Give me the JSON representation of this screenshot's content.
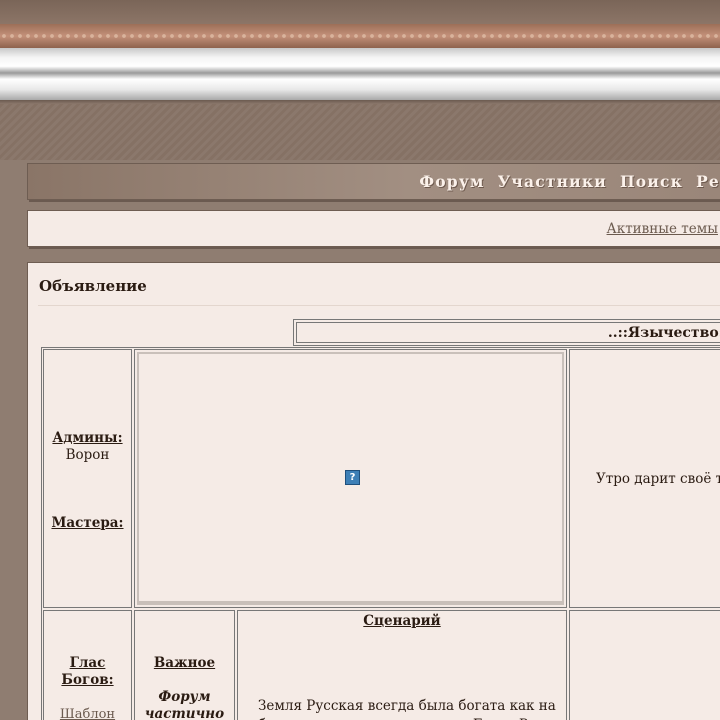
{
  "nav": {
    "items": [
      "Форум",
      "Участники",
      "Поиск",
      "Ре"
    ]
  },
  "links": {
    "active_topics": "Активные темы"
  },
  "announcement": {
    "title": "Объявление",
    "header": "..::Язычество::",
    "admins_label": "Админы:",
    "admins_value": "Ворон",
    "masters_label": "Мастера:",
    "image_icon": "broken-image-icon",
    "morning_text": "Утро дарит своё те",
    "gods_label_1": "Глас",
    "gods_label_2": "Богов:",
    "template_link": "Шаблон",
    "important_label": "Важное",
    "important_text_1": "Форум",
    "important_text_2": "частично",
    "scenario_label": "Сценарий",
    "scenario_text": "Земля Русская всегда была богата как на блага земли, так и на героев. Блага Руси"
  },
  "colors": {
    "page_bg": "#8f7d71",
    "panel_bg": "#f5ebe6",
    "nav_text": "#fbf1ea",
    "link": "#6b5a4e"
  }
}
